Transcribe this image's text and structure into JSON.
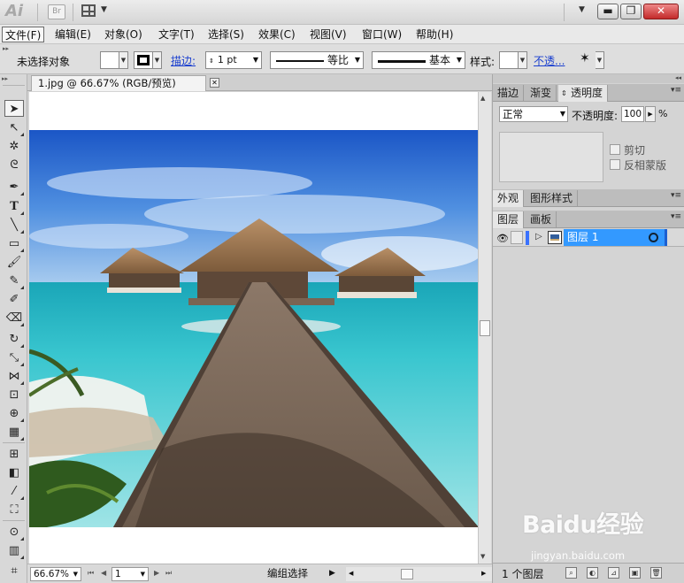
{
  "app": {
    "logo_text": "Ai",
    "bridge_label": "Br"
  },
  "window": {
    "minimize": "▬",
    "restore": "❐",
    "close": "✕"
  },
  "menu": {
    "items": [
      "文件(F)",
      "编辑(E)",
      "对象(O)",
      "文字(T)",
      "选择(S)",
      "效果(C)",
      "视图(V)",
      "窗口(W)",
      "帮助(H)"
    ]
  },
  "control_bar": {
    "selection_status": "未选择对象",
    "stroke_link": "描边:",
    "stroke_weight": "1 pt",
    "profile_label": "等比",
    "brush_label": "基本",
    "style_label": "样式:",
    "opacity_link": "不透..."
  },
  "document": {
    "tab_title": "1.jpg @ 66.67% (RGB/预览)",
    "close_label": "✕"
  },
  "status_bar": {
    "zoom": "66.67%",
    "artboard": "1",
    "label": "编组选择"
  },
  "panels": {
    "top_tabs": [
      "描边",
      "渐变",
      "透明度"
    ],
    "transparency": {
      "blend_mode": "正常",
      "opacity_label": "不透明度:",
      "opacity_value": "100",
      "opacity_unit": "%",
      "clip_label": "剪切",
      "invert_label": "反相蒙版"
    },
    "mid_tabs": [
      "外观",
      "图形样式"
    ],
    "layers_tabs": [
      "图层",
      "画板"
    ],
    "layer": {
      "name": "图层 1"
    },
    "footer": {
      "count": "1 个图层"
    }
  },
  "watermark": {
    "main": "Baidu经验",
    "sub": "jingyan.baidu.com"
  },
  "colors": {
    "selection_blue": "#3399ff",
    "link_blue": "#1a3fcf"
  }
}
